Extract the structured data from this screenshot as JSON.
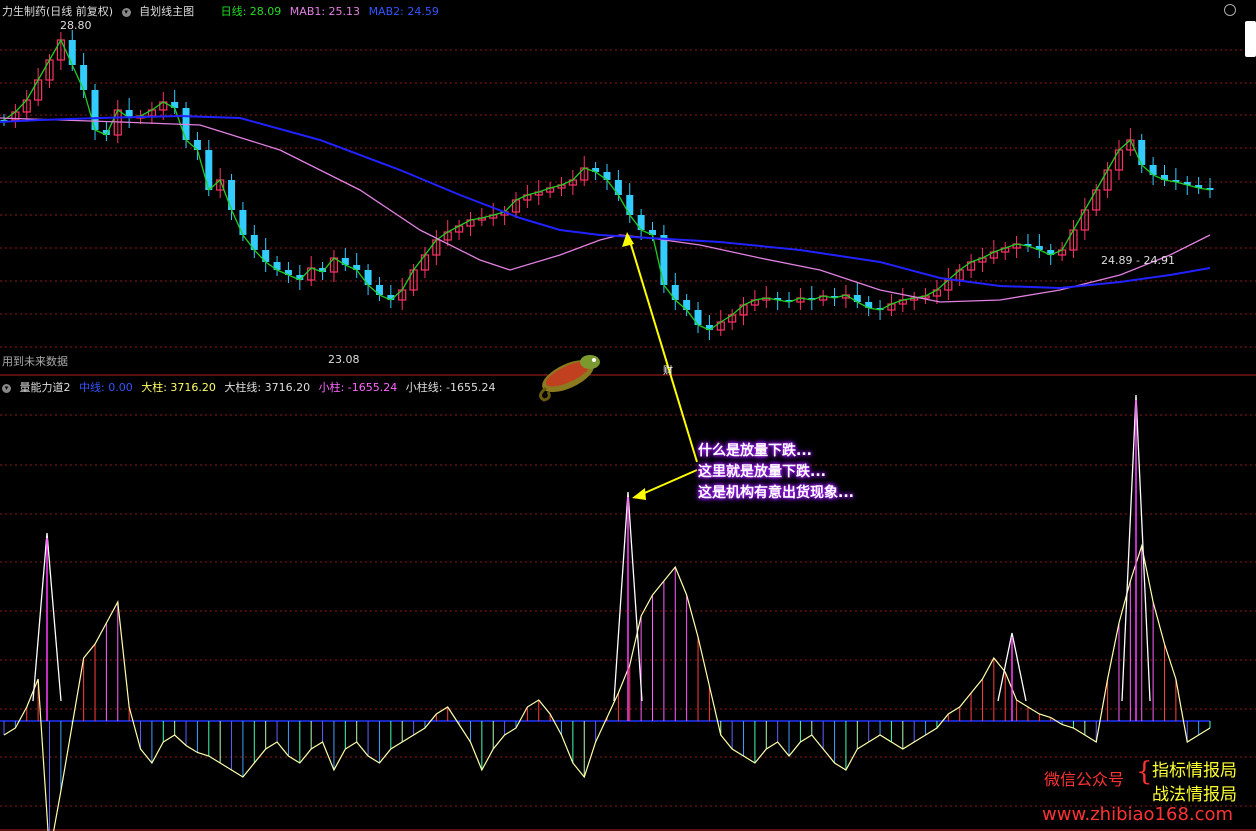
{
  "upper": {
    "stock_title": "力生制药(日线 前复权)",
    "indicator_name": "自划线主图",
    "rixian_label": "日线: 28.09",
    "mab1_label": "MAB1: 25.13",
    "mab2_label": "MAB2: 24.59",
    "high_label": "28.80",
    "low_label": "23.08",
    "range_label": "24.89 - 24.91",
    "future_data_note": "用到未来数据",
    "cai_marker": "财"
  },
  "lower": {
    "indicator_name": "量能力道2",
    "zhongxian": "中线: 0.00",
    "dazhu": "大柱: 3716.20",
    "dazhuxian": "大柱线: 3716.20",
    "xiaozhu": "小柱: -1655.24",
    "xiaozhuxian": "小柱线: -1655.24"
  },
  "annotation": {
    "line1": "什么是放量下跌...",
    "line2": "这里就是放量下跌...",
    "line3": "这是机构有意出货现象..."
  },
  "watermark": {
    "wechat": "微信公众号",
    "brand1": "指标情报局",
    "brand2": "战法情报局",
    "site": "www.zhibiao168.com"
  },
  "colors": {
    "up": "#ff3366",
    "down": "#33ccff",
    "ma_green": "#22cc22",
    "ma_pink": "#e080e0",
    "ma_blue": "#2222ff",
    "grid": "#8b1a1a",
    "arrow": "#ffff00"
  },
  "chart_data": {
    "type": "candlestick+histogram",
    "price_high": 28.8,
    "price_low": 23.08,
    "indicator_max": 3716.2,
    "indicator_min": -1655.24
  }
}
